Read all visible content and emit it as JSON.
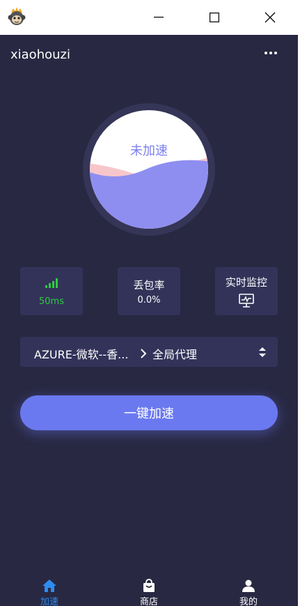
{
  "window": {
    "minimize_icon": "minimize-icon",
    "maximize_icon": "maximize-icon",
    "close_icon": "close-icon"
  },
  "header": {
    "username": "xiaohouzi",
    "menu_icon": "more-dots-icon"
  },
  "accelerator": {
    "status_label": "未加速",
    "colors": {
      "wave": "#8e8ef0",
      "wave_back": "#f7c6cb",
      "ring": "#353557"
    }
  },
  "stats": {
    "latency": {
      "value": "50ms",
      "icon": "signal-icon",
      "color": "#2ecc40"
    },
    "packet_loss": {
      "title": "丢包率",
      "value": "0.0%"
    },
    "monitor": {
      "title": "实时监控",
      "icon": "monitor-icon"
    }
  },
  "server": {
    "name": "AZURE-微软--香...",
    "mode": "全局代理"
  },
  "action": {
    "label": "一键加速",
    "color": "#6b79f0"
  },
  "bottom_nav": {
    "items": [
      {
        "label": "加速",
        "icon": "home-icon",
        "active": true,
        "color": "#2d8cf0"
      },
      {
        "label": "商店",
        "icon": "shopping-bag-icon",
        "active": false
      },
      {
        "label": "我的",
        "icon": "user-icon",
        "active": false
      }
    ]
  }
}
